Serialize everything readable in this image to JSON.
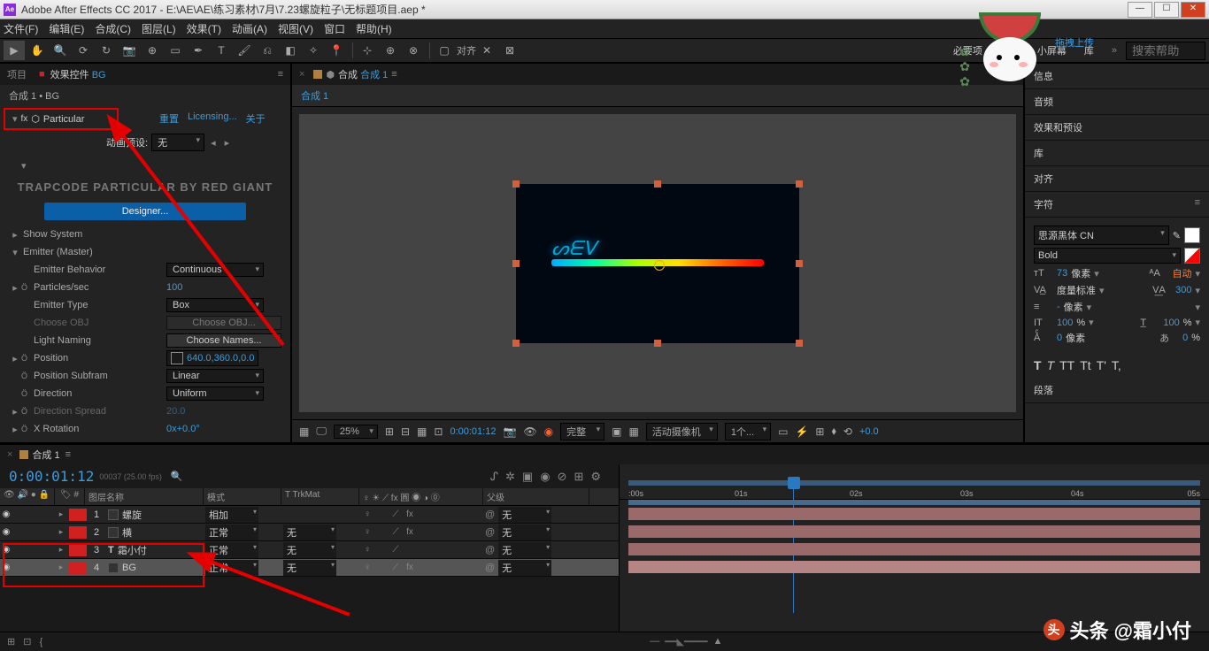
{
  "titlebar": {
    "app_icon": "Ae",
    "title": "Adobe After Effects CC 2017 - E:\\AE\\AE\\练习素材\\7月\\7.23螺旋粒子\\无标题项目.aep *"
  },
  "menubar": [
    "文件(F)",
    "编辑(E)",
    "合成(C)",
    "图层(L)",
    "效果(T)",
    "动画(A)",
    "视图(V)",
    "窗口",
    "帮助(H)"
  ],
  "workspace_tabs": [
    "必要项",
    "标准",
    "小屏幕",
    "库"
  ],
  "mascot_link": "拖拽上传",
  "search_placeholder": "搜索帮助",
  "panel_tabs": {
    "project": "项目",
    "effect_controls": "效果控件",
    "bg_link": "BG",
    "menu": "≡"
  },
  "comp_path": "合成 1 • BG",
  "effect": {
    "name": "Particular",
    "links": {
      "reset": "重置",
      "licensing": "Licensing...",
      "about": "关于"
    },
    "preset_label": "动画预设:",
    "preset_value": "无",
    "brand": "TRAPCODE PARTICULAR BY RED GIANT",
    "designer_btn": "Designer...",
    "show_system": "Show System",
    "emitter_master": "Emitter (Master)",
    "params": [
      {
        "label": "Emitter Behavior",
        "type": "dd",
        "value": "Continuous"
      },
      {
        "label": "Particles/sec",
        "type": "blue",
        "value": "100",
        "sw": true
      },
      {
        "label": "Emitter Type",
        "type": "dd",
        "value": "Box"
      },
      {
        "label": "Choose OBJ",
        "type": "btn-dim",
        "value": "Choose OBJ...",
        "dim": true
      },
      {
        "label": "Light Naming",
        "type": "btn",
        "value": "Choose Names..."
      },
      {
        "label": "Position",
        "type": "pos",
        "value": "640.0,360.0,0.0",
        "sw": true
      },
      {
        "label": "Position Subfram",
        "type": "dd",
        "value": "Linear",
        "sw": true
      },
      {
        "label": "Direction",
        "type": "dd",
        "value": "Uniform",
        "sw": true
      },
      {
        "label": "Direction Spread",
        "type": "blue-dim",
        "value": "20.0",
        "sw": true,
        "dim": true
      },
      {
        "label": "X Rotation",
        "type": "blue",
        "value": "0x+0.0°",
        "sw": true
      }
    ]
  },
  "viewer": {
    "tab_prefix": "合成",
    "tab_name": "合成 1",
    "subtab": "合成 1"
  },
  "viewbar": {
    "zoom": "25%",
    "timecode": "0:00:01:12",
    "quality": "完整",
    "camera": "活动摄像机",
    "views": "1个...",
    "exposure": "+0.0"
  },
  "rightpanels": [
    "信息",
    "音频",
    "效果和预设",
    "库",
    "对齐"
  ],
  "char_panel": {
    "title": "字符",
    "font": "思源黑体 CN",
    "weight": "Bold",
    "size": "73",
    "size_unit": "像素",
    "leading": "自动",
    "kerning": "度量标准",
    "tracking": "300",
    "stroke": "-",
    "stroke_unit": "像素",
    "vscale": "100",
    "hscale": "100",
    "scale_unit": "%",
    "baseline": "0",
    "baseline_unit": "像素",
    "tsume": "0",
    "tsume_unit": "%",
    "styles": [
      "T",
      "T",
      "TT",
      "Tt",
      "T'",
      "T,"
    ]
  },
  "paragraph_title": "段落",
  "timeline": {
    "tab": "合成 1",
    "timecode": "0:00:01:12",
    "fps": "00037 (25.00 fps)",
    "headers": {
      "name": "图层名称",
      "mode": "模式",
      "trkmat": "T  TrkMat",
      "switches": "♀ ☀ ⟋ fx 圓 ◉ ◑ ⓪",
      "parent": "父级"
    },
    "layers": [
      {
        "idx": 1,
        "name": "螺旋",
        "icon": "sq",
        "mode": "相加",
        "trk": "",
        "parent": "无",
        "fx": true
      },
      {
        "idx": 2,
        "name": "横",
        "icon": "sq",
        "mode": "正常",
        "trk": "无",
        "parent": "无",
        "fx": true
      },
      {
        "idx": 3,
        "name": "霜小付",
        "icon": "T",
        "mode": "正常",
        "trk": "无",
        "parent": "无",
        "fx": false
      },
      {
        "idx": 4,
        "name": "BG",
        "icon": "sq",
        "mode": "正常",
        "trk": "无",
        "parent": "无",
        "fx": true,
        "selected": true
      }
    ],
    "ruler": [
      ":00s",
      "01s",
      "02s",
      "03s",
      "04s",
      "05s"
    ],
    "parent_none": "无"
  },
  "watermark": {
    "prefix": "头条",
    "handle": "@霜小付"
  }
}
